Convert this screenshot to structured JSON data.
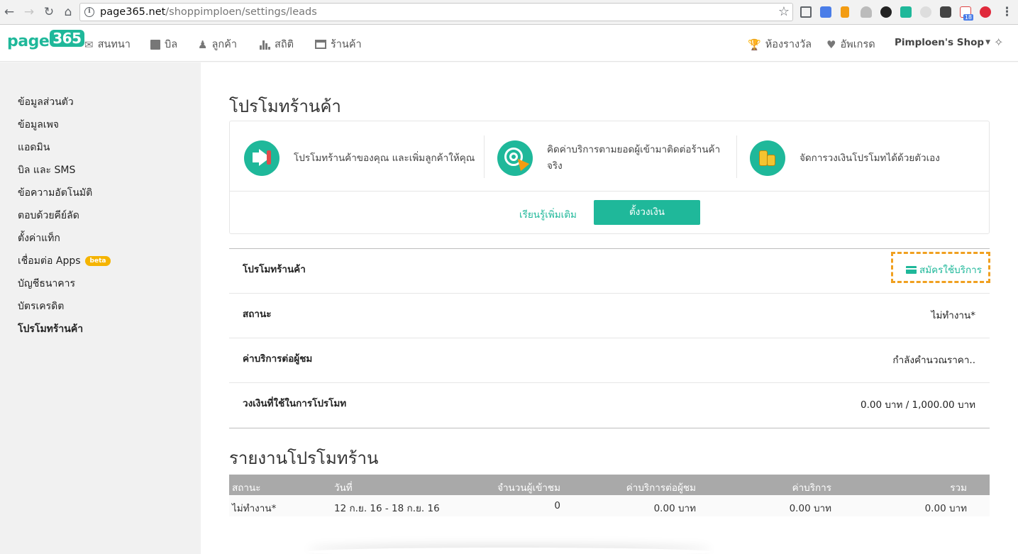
{
  "browser": {
    "url_host": "page365.net",
    "url_path": "/shoppimploen/settings/leads"
  },
  "header": {
    "logo_text": "page",
    "logo_badge": "365",
    "nav": [
      {
        "label": "สนทนา",
        "icon": "envelope-icon"
      },
      {
        "label": "บิล",
        "icon": "shopping-bag-icon"
      },
      {
        "label": "ลูกค้า",
        "icon": "users-icon"
      },
      {
        "label": "สถิติ",
        "icon": "bar-chart-icon"
      },
      {
        "label": "ร้านค้า",
        "icon": "store-icon"
      }
    ],
    "trophy_label": "ห้องรางวัล",
    "upgrade_label": "อัพเกรด",
    "shop_name": "Pimploen's Shop",
    "gmail_count": "18"
  },
  "sidebar": {
    "items": [
      {
        "label": "ข้อมูลส่วนตัว"
      },
      {
        "label": "ข้อมูลเพจ"
      },
      {
        "label": "แอดมิน"
      },
      {
        "label": "บิล และ SMS"
      },
      {
        "label": "ข้อความอัตโนมัติ"
      },
      {
        "label": "ตอบด้วยคีย์ลัด"
      },
      {
        "label": "ตั้งค่าแท็ก"
      },
      {
        "label": "เชื่อมต่อ Apps",
        "badge": "beta"
      },
      {
        "label": "บัญชีธนาคาร"
      },
      {
        "label": "บัตรเครดิต"
      },
      {
        "label": "โปรโมทร้านค้า",
        "active": true
      }
    ]
  },
  "main": {
    "title": "โปรโมทร้านค้า",
    "features": [
      {
        "text": "โปรโมทร้านค้าของคุณ และเพิ่มลูกค้าให้คุณ",
        "icon": "megaphone-icon"
      },
      {
        "text": "คิดค่าบริการตามยอดผู้เข้ามาติดต่อร้านค้าจริง",
        "icon": "target-click-icon"
      },
      {
        "text": "จัดการวงเงินโปรโมทได้ด้วยตัวเอง",
        "icon": "coins-icon"
      }
    ],
    "learn_more": "เรียนรู้เพิ่มเติม",
    "setup_budget": "ตั้งวงเงิน",
    "info_rows": [
      {
        "label": "โปรโมทร้านค้า",
        "action": "สมัครใช้บริการ"
      },
      {
        "label": "สถานะ",
        "value": "ไม่ทำงาน*"
      },
      {
        "label": "ค่าบริการต่อผู้ชม",
        "value": "กำลังคำนวณราคา.."
      },
      {
        "label": "วงเงินที่ใช้ในการโปรโมท",
        "value": "0.00 บาท / 1,000.00 บาท"
      }
    ],
    "report_title": "รายงานโปรโมทร้าน",
    "report_columns": [
      "สถานะ",
      "วันที่",
      "จำนวนผู้เข้าชม",
      "ค่าบริการต่อผู้ชม",
      "ค่าบริการ",
      "รวม"
    ],
    "report_rows": [
      [
        "ไม่ทำงาน*",
        "12 ก.ย. 16 - 18 ก.ย. 16",
        "0",
        "0.00 บาท",
        "0.00 บาท",
        "0.00 บาท"
      ]
    ]
  }
}
